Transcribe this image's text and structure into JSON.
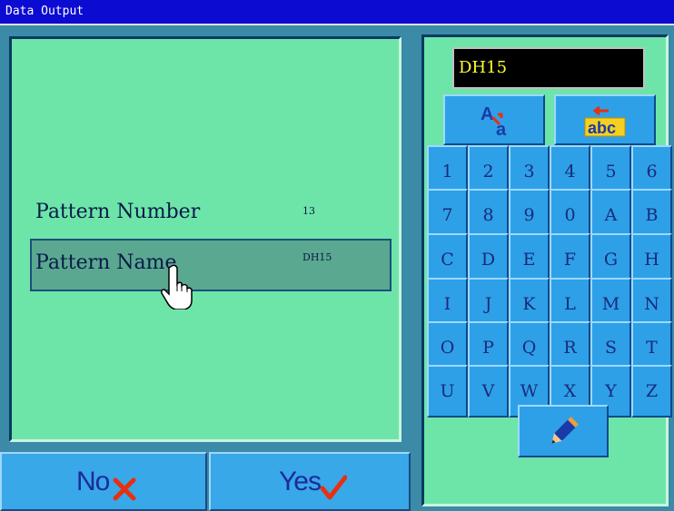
{
  "title": "Data Output",
  "fields": [
    {
      "label": "Pattern Number",
      "value": "13"
    },
    {
      "label": "Pattern Name",
      "value": "DH15"
    }
  ],
  "buttons": {
    "no": "No",
    "yes": "Yes"
  },
  "input": {
    "value": "DH15"
  },
  "keys": [
    "1",
    "2",
    "3",
    "4",
    "5",
    "6",
    "7",
    "8",
    "9",
    "0",
    "A",
    "B",
    "C",
    "D",
    "E",
    "F",
    "G",
    "H",
    "I",
    "J",
    "K",
    "L",
    "M",
    "N",
    "O",
    "P",
    "Q",
    "R",
    "S",
    "T",
    "U",
    "V",
    "W",
    "X",
    "Y",
    "Z"
  ],
  "icons": {
    "case_toggle": "case-toggle-icon",
    "backspace_abc": "abc",
    "edit": "pencil-icon",
    "hand_cursor": "hand-pointer-icon"
  },
  "colors": {
    "title_bar": "#0b0bd2",
    "panel": "#6ee5a8",
    "key": "#2ea0e8",
    "display_text": "#ffff30"
  }
}
